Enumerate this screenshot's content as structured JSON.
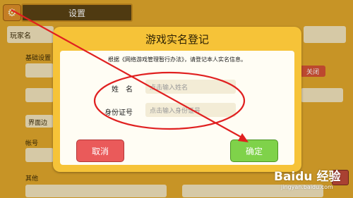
{
  "header": {
    "title": "设置",
    "gear_icon": "gear-icon"
  },
  "background": {
    "player_name_label": "玩家名",
    "basic_settings_label": "基础设置",
    "close_toggle": "关闭",
    "interface_label": "界面边",
    "account_label": "帐号",
    "other_label": "其他"
  },
  "dialog": {
    "title": "游戏实名登记",
    "notice": "根据《网络游戏管理暂行办法》，请登记本人实名信息。",
    "name_label": "姓　名",
    "name_placeholder": "点击输入姓名",
    "id_label": "身份证号",
    "id_placeholder": "点击输入身份证号",
    "cancel_label": "取消",
    "confirm_label": "确定"
  },
  "watermark": {
    "text": "Baidu 经验",
    "url": "jingyan.baidu.com"
  },
  "colors": {
    "dialog": "#f6c338",
    "cancel": "#ea5a5a",
    "confirm": "#7fd24a",
    "annotation": "#e02020"
  }
}
